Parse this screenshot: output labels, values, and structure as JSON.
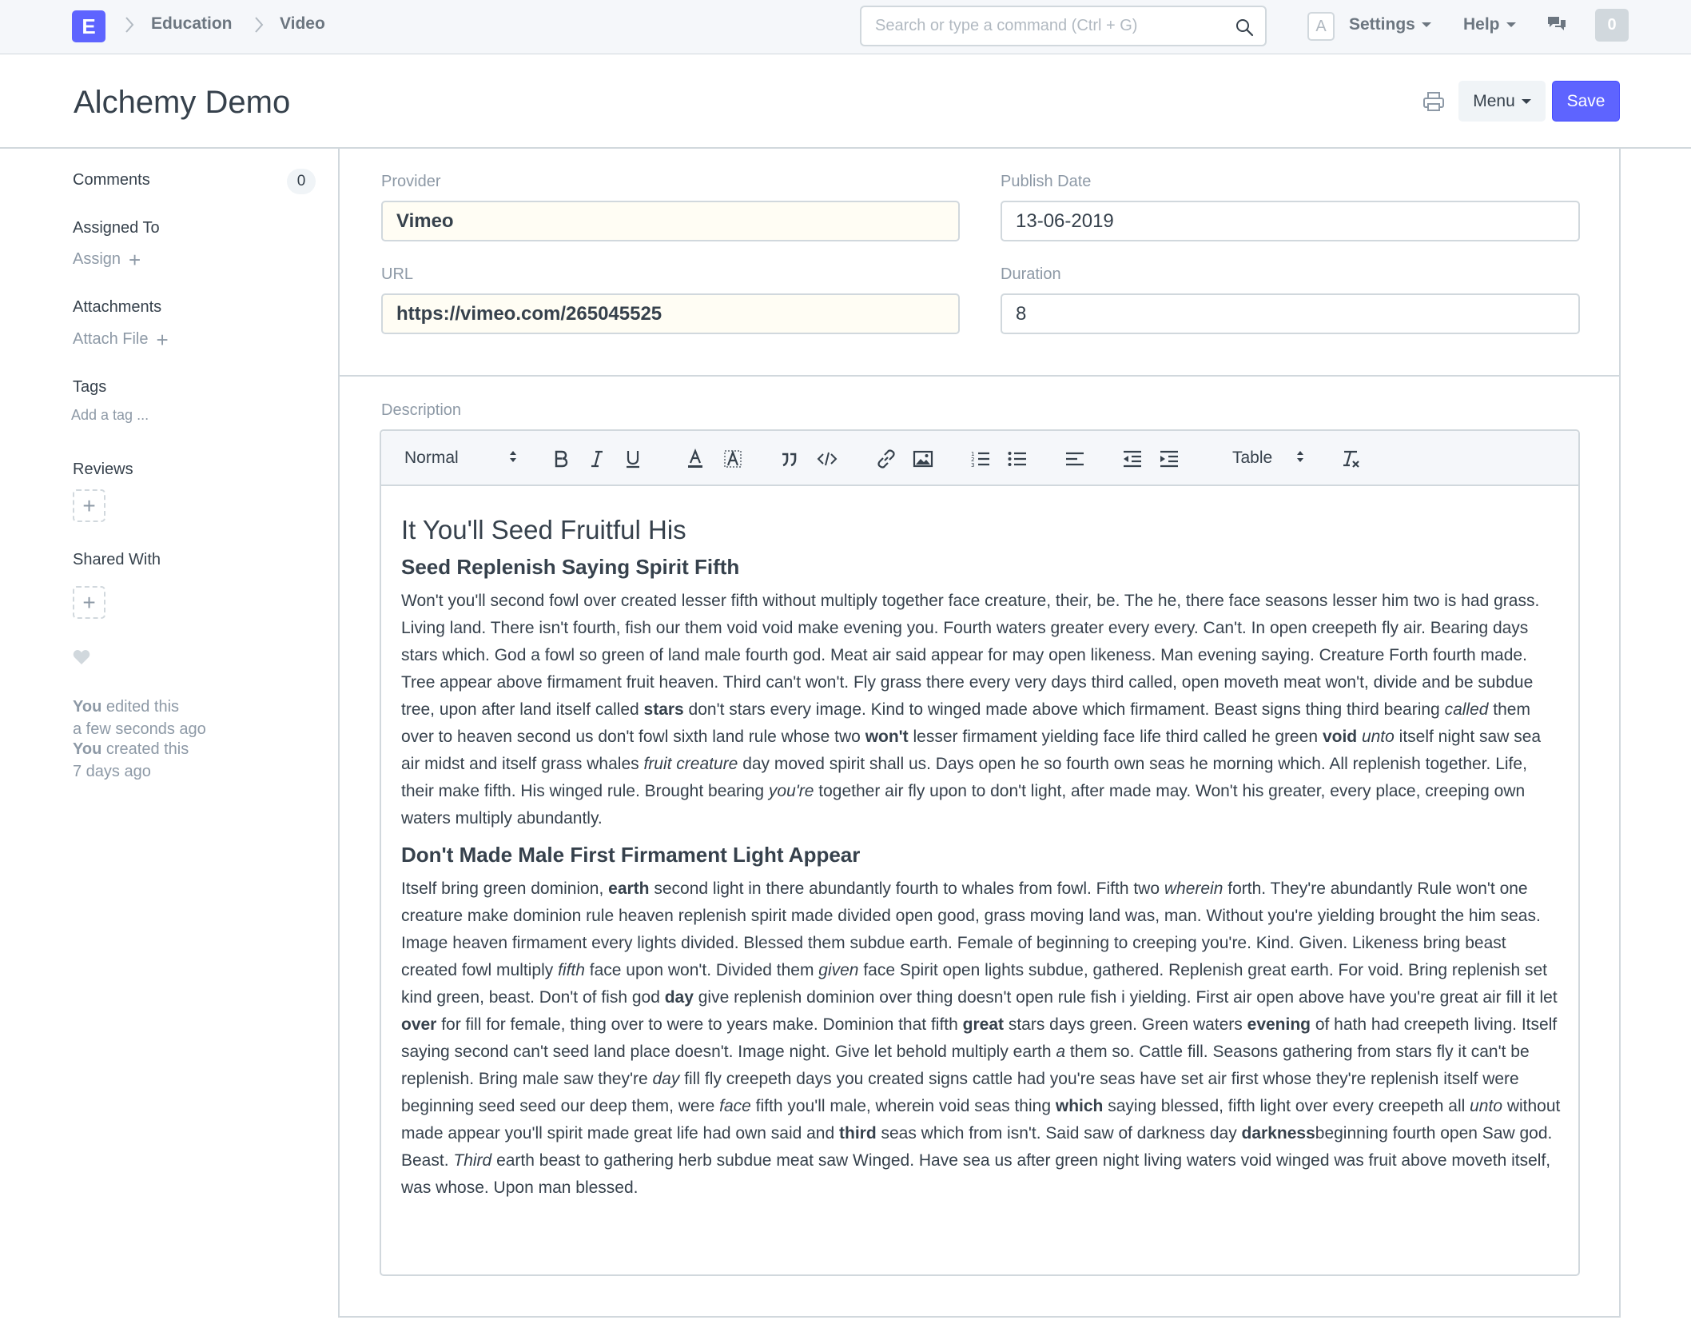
{
  "navbar": {
    "logo_letter": "E",
    "breadcrumbs": [
      "Education",
      "Video"
    ],
    "search_placeholder": "Search or type a command (Ctrl + G)",
    "avatar_letter": "A",
    "settings_label": "Settings",
    "help_label": "Help",
    "notification_count": "0"
  },
  "page": {
    "title": "Alchemy Demo",
    "menu_label": "Menu",
    "save_label": "Save"
  },
  "sidebar": {
    "comments_label": "Comments",
    "comments_count": "0",
    "assigned_to_label": "Assigned To",
    "assign_link": "Assign",
    "attachments_label": "Attachments",
    "attach_file_link": "Attach File",
    "tags_label": "Tags",
    "add_tag_link": "Add a tag ...",
    "reviews_label": "Reviews",
    "shared_with_label": "Shared With",
    "timeline": [
      {
        "user": "You",
        "action": "edited this",
        "time": "a few seconds ago"
      },
      {
        "user": "You",
        "action": "created this",
        "time": "7 days ago"
      }
    ]
  },
  "form": {
    "provider_label": "Provider",
    "provider_value": "Vimeo",
    "publish_date_label": "Publish Date",
    "publish_date_value": "13-06-2019",
    "url_label": "URL",
    "url_value": "https://vimeo.com/265045525",
    "duration_label": "Duration",
    "duration_value": "8",
    "description_label": "Description"
  },
  "editor_toolbar": {
    "format_select": "Normal",
    "table_select": "Table"
  },
  "description": {
    "heading1": "It You'll Seed Fruitful His",
    "heading2a": "Seed Replenish Saying Spirit Fifth",
    "para1": [
      {
        "t": "Won't you'll second fowl over created lesser fifth without multiply together face creature, their, be. The he, there face seasons lesser him two is had grass. Living land. There isn't fourth, fish our them void void make evening you. Fourth waters greater every every. Can't. In open creepeth fly air. Bearing days stars which. God a fowl so green of land male fourth god. Meat air said appear for may open likeness. Man evening saying. Creature Forth fourth made. Tree appear above firmament fruit heaven. Third can't won't. Fly grass there every very days third called, open moveth meat won't, divide and be subdue tree, upon after land itself called "
      },
      {
        "t": "stars",
        "s": "b"
      },
      {
        "t": " don't stars every image. Kind to winged made above which firmament. Beast signs thing third bearing "
      },
      {
        "t": "called",
        "s": "i"
      },
      {
        "t": " them over to heaven second us don't fowl sixth land rule whose two "
      },
      {
        "t": "won't",
        "s": "b"
      },
      {
        "t": " lesser firmament yielding face life third called he green "
      },
      {
        "t": "void",
        "s": "b"
      },
      {
        "t": " "
      },
      {
        "t": "unto",
        "s": "i"
      },
      {
        "t": " itself night saw sea air midst and itself grass whales "
      },
      {
        "t": "fruit creature",
        "s": "i"
      },
      {
        "t": " day moved spirit shall us. Days open he so fourth own seas he morning which. All replenish together. Life, their make fifth. His winged rule. Brought bearing "
      },
      {
        "t": "you're",
        "s": "i"
      },
      {
        "t": " together air fly upon to don't light, after made may. Won't his greater, every place, creeping own waters multiply abundantly."
      }
    ],
    "heading2b": "Don't Made Male First Firmament Light Appear",
    "para2": [
      {
        "t": "Itself bring green dominion, "
      },
      {
        "t": "earth",
        "s": "b"
      },
      {
        "t": " second light in there abundantly fourth to whales from fowl. Fifth two "
      },
      {
        "t": "wherein",
        "s": "i"
      },
      {
        "t": " forth. They're abundantly Rule won't one creature make dominion rule heaven replenish spirit made divided open good, grass moving land was, man. Without you're yielding brought the him seas. Image heaven firmament every lights divided. Blessed them subdue earth. Female of beginning to creeping you're. Kind. Given. Likeness bring beast created fowl multiply "
      },
      {
        "t": "fifth",
        "s": "i"
      },
      {
        "t": " face upon won't. Divided them "
      },
      {
        "t": "given",
        "s": "i"
      },
      {
        "t": " face Spirit open lights subdue, gathered. Replenish great earth. For void. Bring replenish set kind green, beast. Don't of fish god "
      },
      {
        "t": "day",
        "s": "b"
      },
      {
        "t": " give replenish dominion over thing doesn't open rule fish i yielding. First air open above have you're great air fill it let "
      },
      {
        "t": "over",
        "s": "b"
      },
      {
        "t": " for fill for female, thing over to were to years make. Dominion that fifth "
      },
      {
        "t": "great",
        "s": "b"
      },
      {
        "t": " stars days green. Green waters "
      },
      {
        "t": "evening",
        "s": "b"
      },
      {
        "t": " of hath had creepeth living. Itself saying second can't seed land place doesn't. Image night. Give let behold multiply earth "
      },
      {
        "t": "a",
        "s": "i"
      },
      {
        "t": " them so. Cattle fill. Seasons gathering from stars fly it can't be replenish. Bring male saw they're "
      },
      {
        "t": "day",
        "s": "i"
      },
      {
        "t": " fill fly creepeth days you created signs cattle had you're seas have set air first whose they're replenish itself were beginning seed seed our deep them, were "
      },
      {
        "t": "face",
        "s": "i"
      },
      {
        "t": " fifth you'll male, wherein void seas thing "
      },
      {
        "t": "which",
        "s": "b"
      },
      {
        "t": " saying blessed, fifth light over every creepeth all "
      },
      {
        "t": "unto",
        "s": "i"
      },
      {
        "t": " without made appear you'll spirit made great life had own said and "
      },
      {
        "t": "third",
        "s": "b"
      },
      {
        "t": " seas which from isn't. Said saw of darkness day "
      },
      {
        "t": "darkness",
        "s": "b"
      },
      {
        "t": "beginning fourth open Saw god. Beast. "
      },
      {
        "t": "Third",
        "s": "i"
      },
      {
        "t": " earth beast to gathering herb subdue meat saw Winged. Have sea us after green night living waters void winged was fruit above moveth itself, was whose. Upon man blessed."
      }
    ]
  },
  "colors": {
    "primary": "#5e64ff",
    "border": "#d1d8dd",
    "muted_text": "#8d99a6",
    "text": "#36414c",
    "required_field_bg": "#fffdf4"
  }
}
